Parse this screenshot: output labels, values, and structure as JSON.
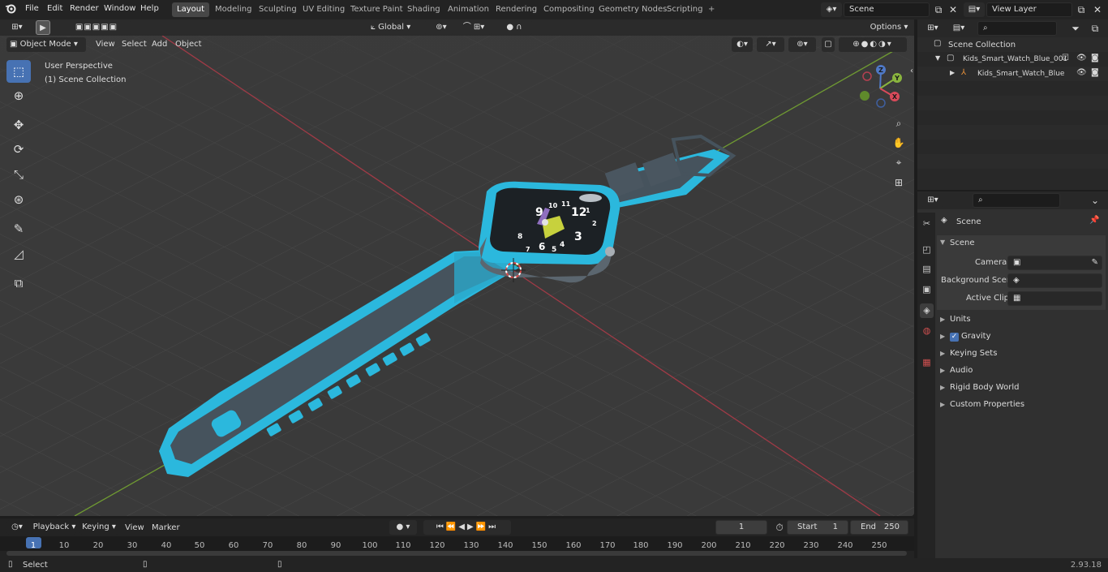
{
  "topbar": {
    "menus": [
      "File",
      "Edit",
      "Render",
      "Window",
      "Help"
    ],
    "workspaces": [
      "Layout",
      "Modeling",
      "Sculpting",
      "UV Editing",
      "Texture Paint",
      "Shading",
      "Animation",
      "Rendering",
      "Compositing",
      "Geometry Nodes",
      "Scripting"
    ],
    "add_tab": "+",
    "scene_name": "Scene",
    "view_layer": "View Layer"
  },
  "viewport_header": {
    "transform_orientation": "Global",
    "options": "Options",
    "mode": "Object Mode",
    "menus": [
      "View",
      "Select",
      "Add",
      "Object"
    ]
  },
  "viewport": {
    "perspective": "User Perspective",
    "collection": "(1) Scene Collection",
    "watch_numbers": [
      "12",
      "9",
      "3",
      "6",
      "10",
      "11",
      "8",
      "4",
      "5",
      "1",
      "2",
      "7"
    ],
    "gizmo": {
      "x": "X",
      "y": "Y",
      "z": "Z"
    }
  },
  "outliner": {
    "search_placeholder": "",
    "root": "Scene Collection",
    "items": [
      "Kids_Smart_Watch_Blue_001",
      "Kids_Smart_Watch_Blue"
    ]
  },
  "properties": {
    "context": "Scene",
    "panel": "Scene",
    "rows": [
      {
        "label": "Camera",
        "value": ""
      },
      {
        "label": "Background Scene",
        "value": ""
      },
      {
        "label": "Active Clip",
        "value": ""
      }
    ],
    "sections": [
      "Units",
      "Gravity",
      "Keying Sets",
      "Audio",
      "Rigid Body World",
      "Custom Properties"
    ]
  },
  "timeline": {
    "menus": [
      "Playback",
      "Keying",
      "View",
      "Marker"
    ],
    "current_frame": "1",
    "start_label": "Start",
    "start": "1",
    "end_label": "End",
    "end": "250",
    "ticks": [
      "1",
      "10",
      "20",
      "30",
      "40",
      "50",
      "60",
      "70",
      "80",
      "90",
      "100",
      "110",
      "120",
      "130",
      "140",
      "150",
      "160",
      "170",
      "180",
      "190",
      "200",
      "210",
      "220",
      "230",
      "240",
      "250"
    ]
  },
  "status": {
    "left": "Select",
    "version": "2.93.18"
  },
  "colors": {
    "accent": "#4772b3",
    "band": "#2bb8dd",
    "band_dark": "#45525c",
    "axis_x": "#a03a46",
    "axis_y": "#6f9a32"
  }
}
